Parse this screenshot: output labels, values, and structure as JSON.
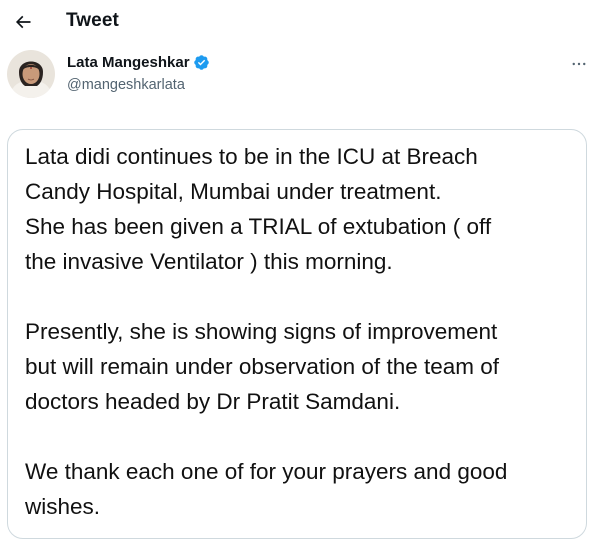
{
  "header": {
    "title": "Tweet",
    "back_icon": "arrow-left-icon"
  },
  "author": {
    "name": "Lata Mangeshkar",
    "handle": "@mangeshkarlata",
    "verified_icon": "verified-badge-icon",
    "more_icon": "more-horizontal-icon"
  },
  "media": {
    "paragraphs": [
      {
        "lines": [
          "Lata didi continues to be in the ICU at Breach",
          "Candy Hospital, Mumbai under treatment.",
          "She has been given a TRIAL of extubation ( off",
          "the invasive Ventilator ) this morning."
        ]
      },
      {
        "lines": [
          "Presently, she is showing signs of improvement",
          "but will remain under observation of the team of",
          "doctors headed by Dr Pratit Samdani."
        ]
      },
      {
        "lines": [
          "We thank each one of for your prayers and good",
          "wishes."
        ]
      }
    ]
  },
  "colors": {
    "text_primary": "#0f1419",
    "text_secondary": "#536471",
    "verified_blue": "#1d9bf0",
    "border": "#cfd9de"
  }
}
